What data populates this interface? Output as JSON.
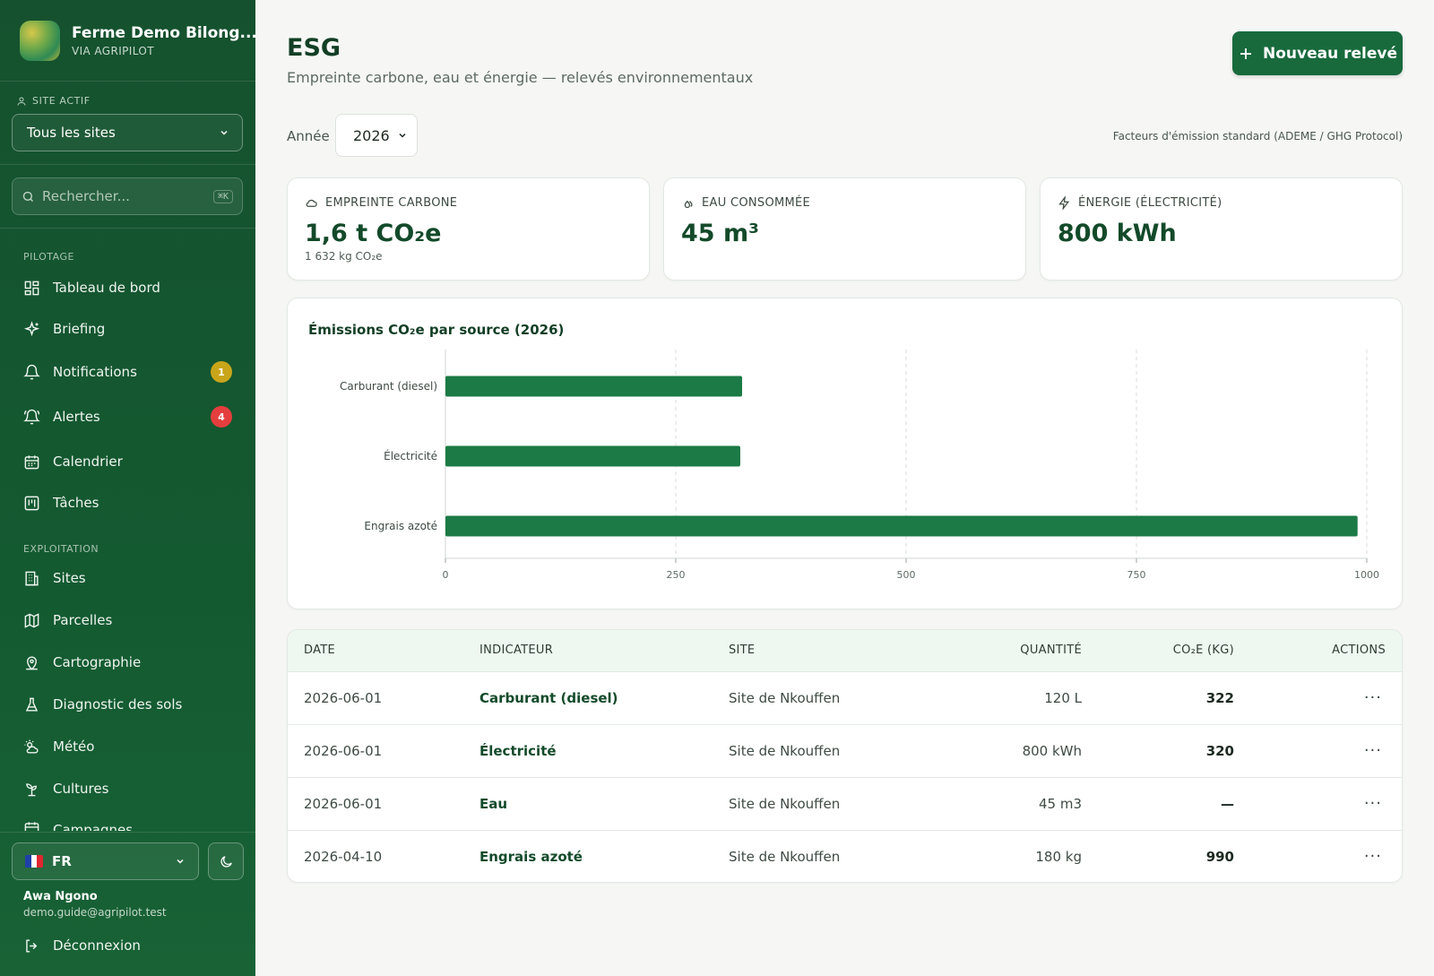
{
  "sidebar": {
    "brand_name": "Ferme Demo Bilong...",
    "brand_sub": "VIA AGRIPILOT",
    "site_label": "SITE ACTIF",
    "site_value": "Tous les sites",
    "search_placeholder": "Rechercher...",
    "search_shortcut": "⌘K",
    "sections": {
      "pilotage": "PILOTAGE",
      "exploitation": "EXPLOITATION"
    },
    "items": [
      {
        "label": "Tableau de bord",
        "icon": "grid-icon"
      },
      {
        "label": "Briefing",
        "icon": "sparkles-icon"
      },
      {
        "label": "Notifications",
        "icon": "bell-icon",
        "badge": "1",
        "badge_color": "#c9a51a"
      },
      {
        "label": "Alertes",
        "icon": "bell-ring-icon",
        "badge": "4",
        "badge_color": "#e53e3e"
      },
      {
        "label": "Calendrier",
        "icon": "calendar-icon"
      },
      {
        "label": "Tâches",
        "icon": "tasks-icon"
      },
      {
        "label": "Sites",
        "icon": "building-icon"
      },
      {
        "label": "Parcelles",
        "icon": "map-icon"
      },
      {
        "label": "Cartographie",
        "icon": "map-pin-icon"
      },
      {
        "label": "Diagnostic des sols",
        "icon": "flask-icon"
      },
      {
        "label": "Météo",
        "icon": "weather-icon"
      },
      {
        "label": "Cultures",
        "icon": "sprout-icon"
      },
      {
        "label": "Campagnes",
        "icon": "calendar-icon"
      }
    ],
    "language": "FR",
    "user_name": "Awa Ngono",
    "user_email": "demo.guide@agripilot.test",
    "logout_label": "Déconnexion"
  },
  "header": {
    "title": "ESG",
    "subtitle": "Empreinte carbone, eau et énergie — relevés environnementaux",
    "new_button": "Nouveau relevé",
    "year_label": "Année",
    "year_value": "2026",
    "factors_note": "Facteurs d'émission standard (ADEME / GHG Protocol)"
  },
  "kpis": [
    {
      "label": "EMPREINTE CARBONE",
      "value": "1,6 t CO₂e",
      "sub": "1 632 kg CO₂e",
      "icon": "cloud-icon"
    },
    {
      "label": "EAU CONSOMMÉE",
      "value": "45 m³",
      "icon": "droplets-icon"
    },
    {
      "label": "ÉNERGIE (ÉLECTRICITÉ)",
      "value": "800 kWh",
      "icon": "zap-icon"
    }
  ],
  "chart_data": {
    "type": "bar",
    "orientation": "horizontal",
    "title": "Émissions CO₂e par source (2026)",
    "categories": [
      "Carburant (diesel)",
      "Électricité",
      "Engrais azoté"
    ],
    "values": [
      322,
      320,
      990
    ],
    "xlim": [
      0,
      1000
    ],
    "ticks": [
      "0",
      "250",
      "500",
      "750",
      "1000"
    ],
    "grid": true,
    "color": "#1b7a45"
  },
  "table": {
    "columns": [
      "DATE",
      "INDICATEUR",
      "SITE",
      "QUANTITÉ",
      "CO₂E (KG)",
      "ACTIONS"
    ],
    "rows": [
      {
        "date": "2026-06-01",
        "indicateur": "Carburant (diesel)",
        "site": "Site de Nkouffen",
        "quantite": "120 L",
        "co2": "322",
        "action": "···"
      },
      {
        "date": "2026-06-01",
        "indicateur": "Électricité",
        "site": "Site de Nkouffen",
        "quantite": "800 kWh",
        "co2": "320",
        "action": "···"
      },
      {
        "date": "2026-06-01",
        "indicateur": "Eau",
        "site": "Site de Nkouffen",
        "quantite": "45 m3",
        "co2": "—",
        "action": "···"
      },
      {
        "date": "2026-04-10",
        "indicateur": "Engrais azoté",
        "site": "Site de Nkouffen",
        "quantite": "180 kg",
        "co2": "990",
        "action": "···"
      }
    ]
  }
}
